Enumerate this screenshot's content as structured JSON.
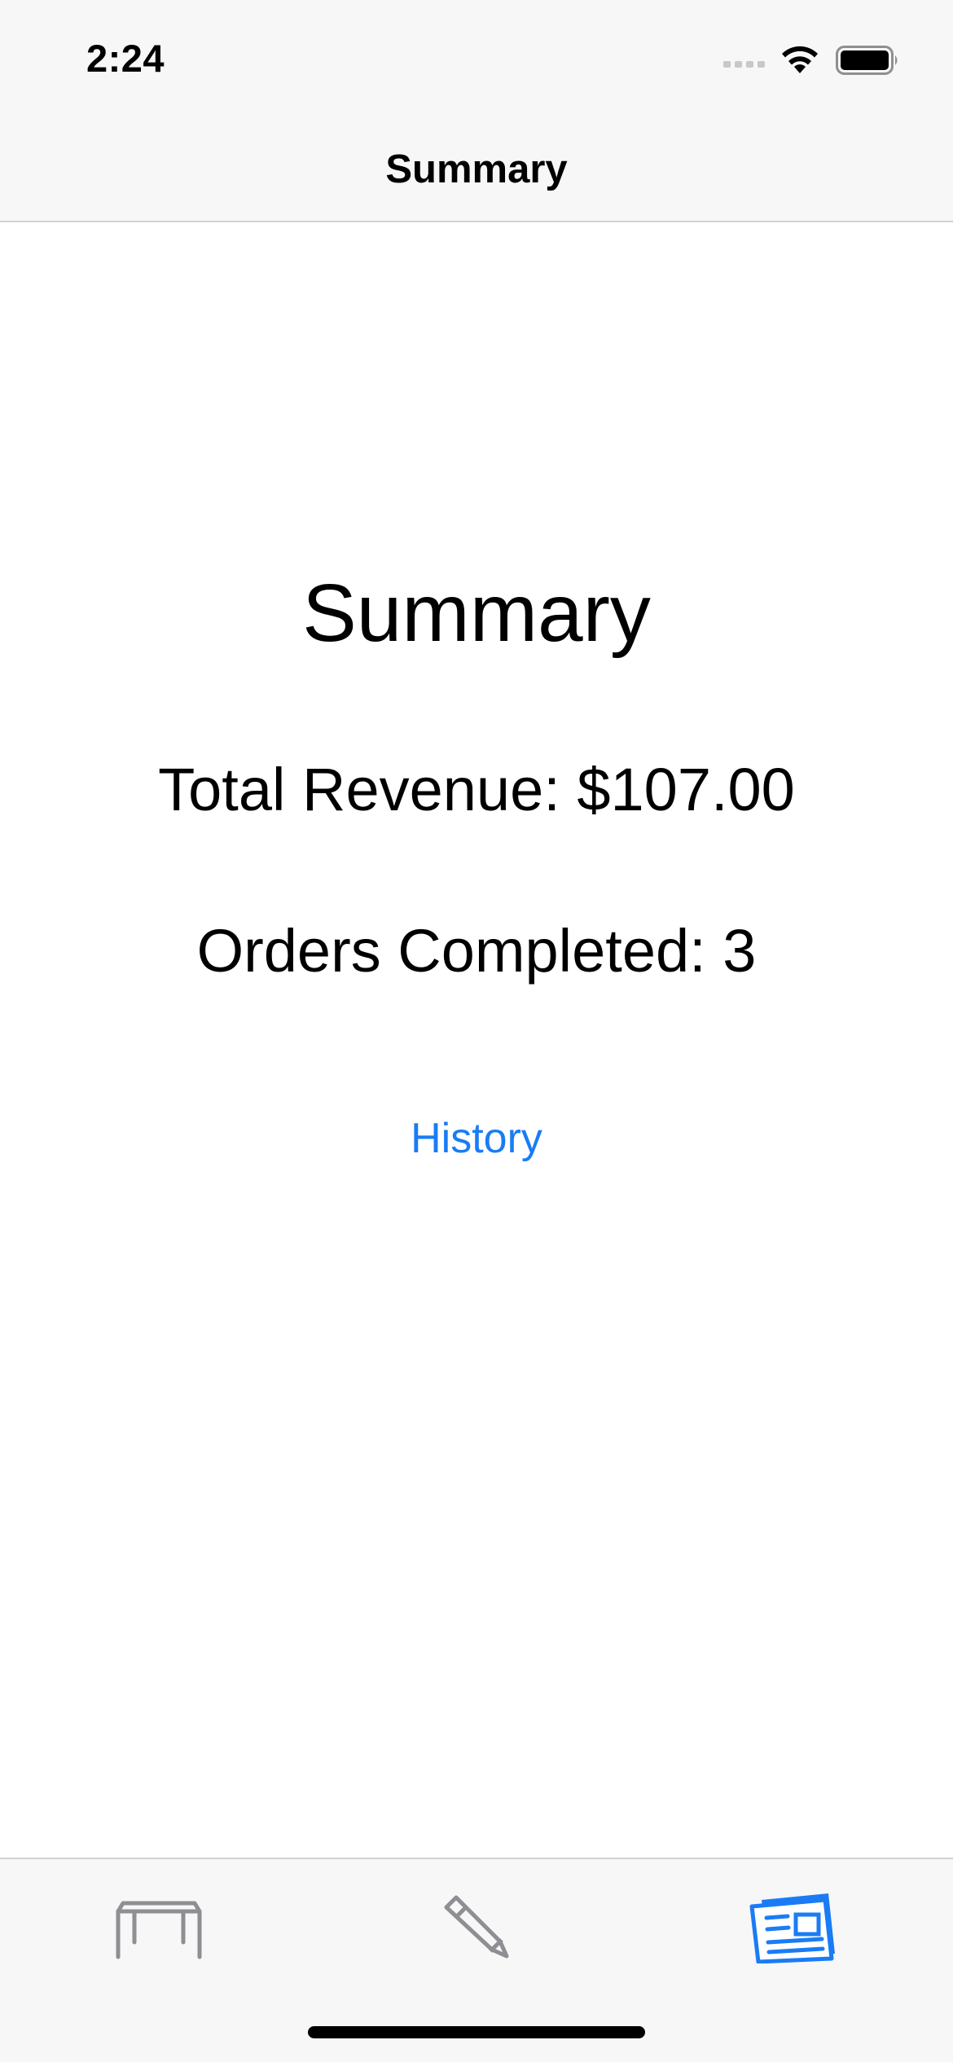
{
  "status_bar": {
    "time": "2:24",
    "icons": [
      "cellular-signal-icon",
      "wifi-icon",
      "battery-icon"
    ]
  },
  "nav_bar": {
    "title": "Summary"
  },
  "main": {
    "heading": "Summary",
    "total_revenue": "Total Revenue: $107.00",
    "orders_completed": "Orders Completed: 3",
    "history_link": "History"
  },
  "tab_bar": {
    "tabs": [
      {
        "icon": "table-icon",
        "selected": false
      },
      {
        "icon": "pencil-icon",
        "selected": false
      },
      {
        "icon": "newspaper-icon",
        "selected": true
      }
    ]
  },
  "colors": {
    "accent": "#1a7cf5",
    "inactive_tab": "#8e8e93",
    "bar_background": "#f7f7f7",
    "separator": "#d2d2d4",
    "text": "#000000"
  }
}
